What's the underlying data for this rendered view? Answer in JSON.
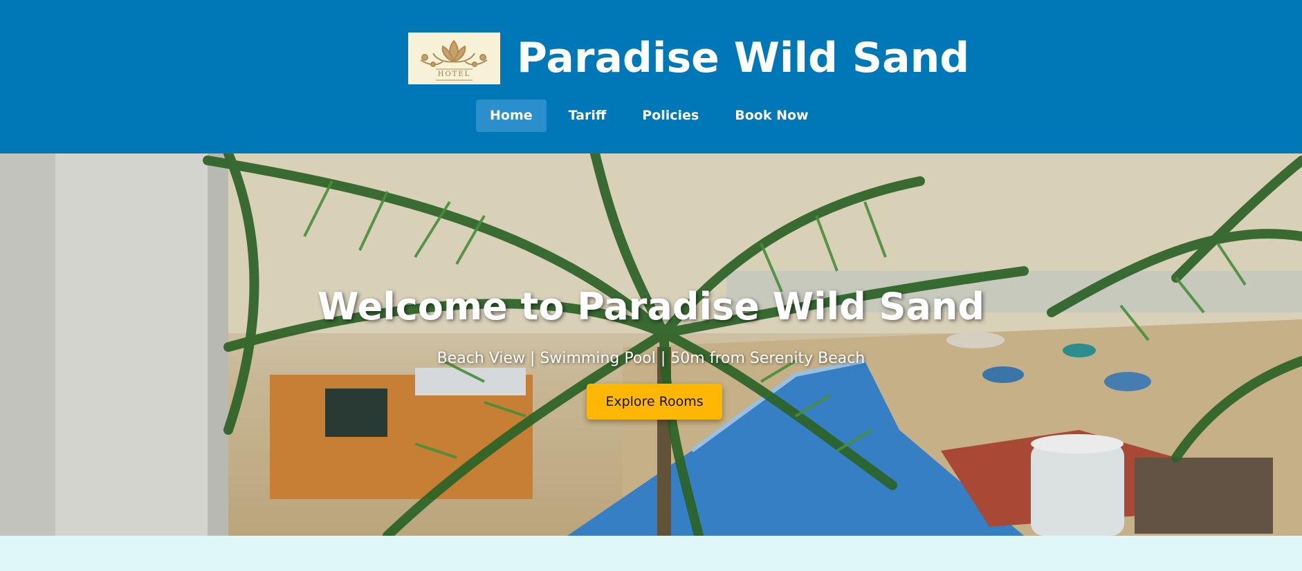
{
  "header": {
    "logo_text": "HOTEL",
    "title": "Paradise Wild Sand",
    "background_color": "#0077b6"
  },
  "nav": {
    "items": [
      {
        "label": "Home",
        "active": true
      },
      {
        "label": "Tariff",
        "active": false
      },
      {
        "label": "Policies",
        "active": false
      },
      {
        "label": "Book Now",
        "active": false
      }
    ]
  },
  "hero": {
    "heading": "Welcome to Paradise Wild Sand",
    "subheading": "Beach View | Swimming Pool | 50m from Serenity Beach",
    "cta_label": "Explore Rooms",
    "cta_color": "#ffb703"
  },
  "page": {
    "background_color": "#e0f7fa"
  }
}
